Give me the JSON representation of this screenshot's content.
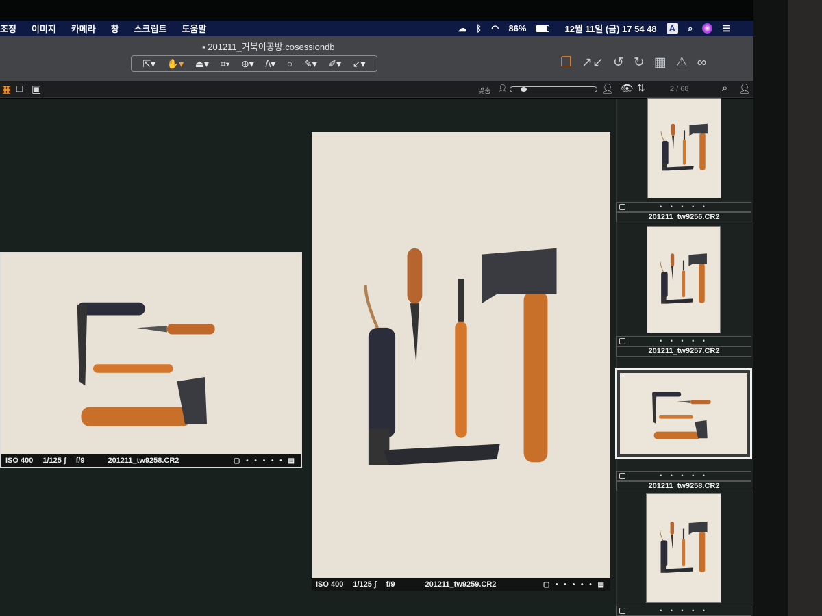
{
  "menubar": {
    "items": [
      "조정",
      "이미지",
      "카메라",
      "창",
      "스크립트",
      "도움말"
    ],
    "battery": "86%",
    "datetime": "12월 11일 (금)  17 54 48",
    "input_source": "A"
  },
  "window": {
    "title": "201211_거북이공방.cosessiondb"
  },
  "toolbar": {
    "tools": [
      "select",
      "pan",
      "loupe",
      "crop",
      "rotate",
      "keystone",
      "spot",
      "brush",
      "color-picker",
      "annotate"
    ]
  },
  "viewer_bar": {
    "fit_label": "맞춤",
    "zoom_level": 0.15,
    "counter": "2 / 68"
  },
  "viewer": {
    "images": [
      {
        "iso": "ISO 400",
        "shutter": "1/125 ʃ",
        "aperture": "f/9",
        "filename": "201211_tw9258.CR2"
      },
      {
        "iso": "ISO 400",
        "shutter": "1/125 ʃ",
        "aperture": "f/9",
        "filename": "201211_tw9259.CR2"
      }
    ]
  },
  "filmstrip": {
    "items": [
      {
        "filename": "201211_tw9256.CR2",
        "rating": "• • • • •"
      },
      {
        "filename": "201211_tw9257.CR2",
        "rating": "• • • • •"
      },
      {
        "filename": "201211_tw9258.CR2",
        "rating": "• • • • •",
        "selected": true
      },
      {
        "filename": "",
        "rating": "• • • • •"
      }
    ]
  },
  "colors": {
    "menubar": "#0f1a44",
    "accent": "#f0a040"
  }
}
